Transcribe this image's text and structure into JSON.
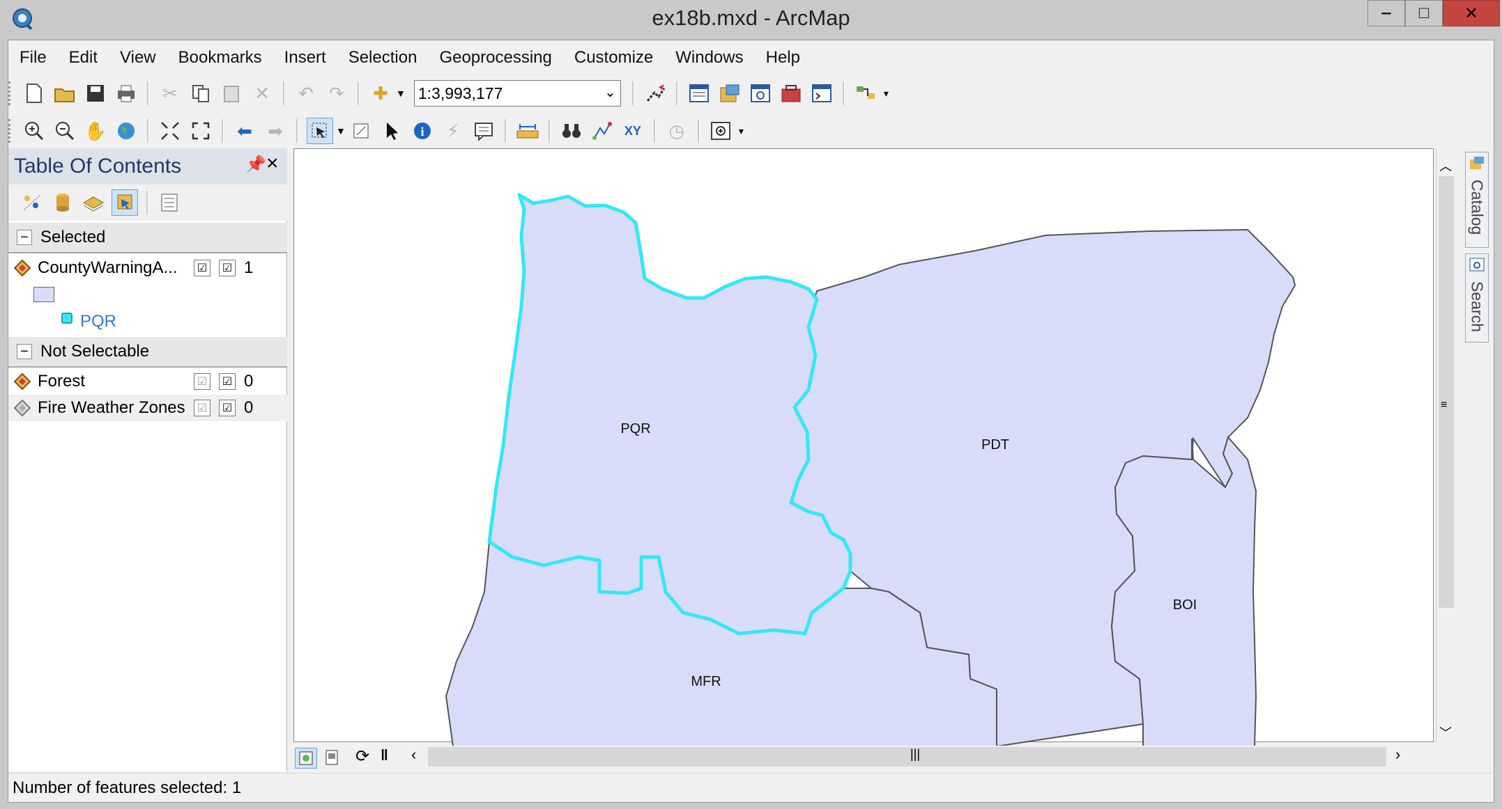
{
  "window": {
    "title": "ex18b.mxd - ArcMap",
    "minimize_glyph": "‒",
    "maximize_glyph": "□",
    "close_glyph": "✕"
  },
  "menu": [
    "File",
    "Edit",
    "View",
    "Bookmarks",
    "Insert",
    "Selection",
    "Geoprocessing",
    "Customize",
    "Windows",
    "Help"
  ],
  "toolbar": {
    "scale_value": "1:3,993,177"
  },
  "toc": {
    "title": "Table Of Contents",
    "groups": [
      {
        "label": "Selected",
        "layers": [
          {
            "name": "CountyWarningA...",
            "count": "1",
            "sublabel": "PQR"
          }
        ]
      },
      {
        "label": "Not Selectable",
        "layers": [
          {
            "name": "Forest",
            "count": "0"
          },
          {
            "name": "Fire Weather Zones",
            "count": "0"
          }
        ]
      }
    ]
  },
  "map": {
    "labels": [
      "PQR",
      "PDT",
      "BOI",
      "MFR"
    ],
    "fill_color": "#d9dcf8",
    "selection_color": "#33e8f4",
    "outline_color": "#555555"
  },
  "side_tabs": [
    "Catalog",
    "Search"
  ],
  "status": {
    "text": "Number of features selected: 1"
  }
}
